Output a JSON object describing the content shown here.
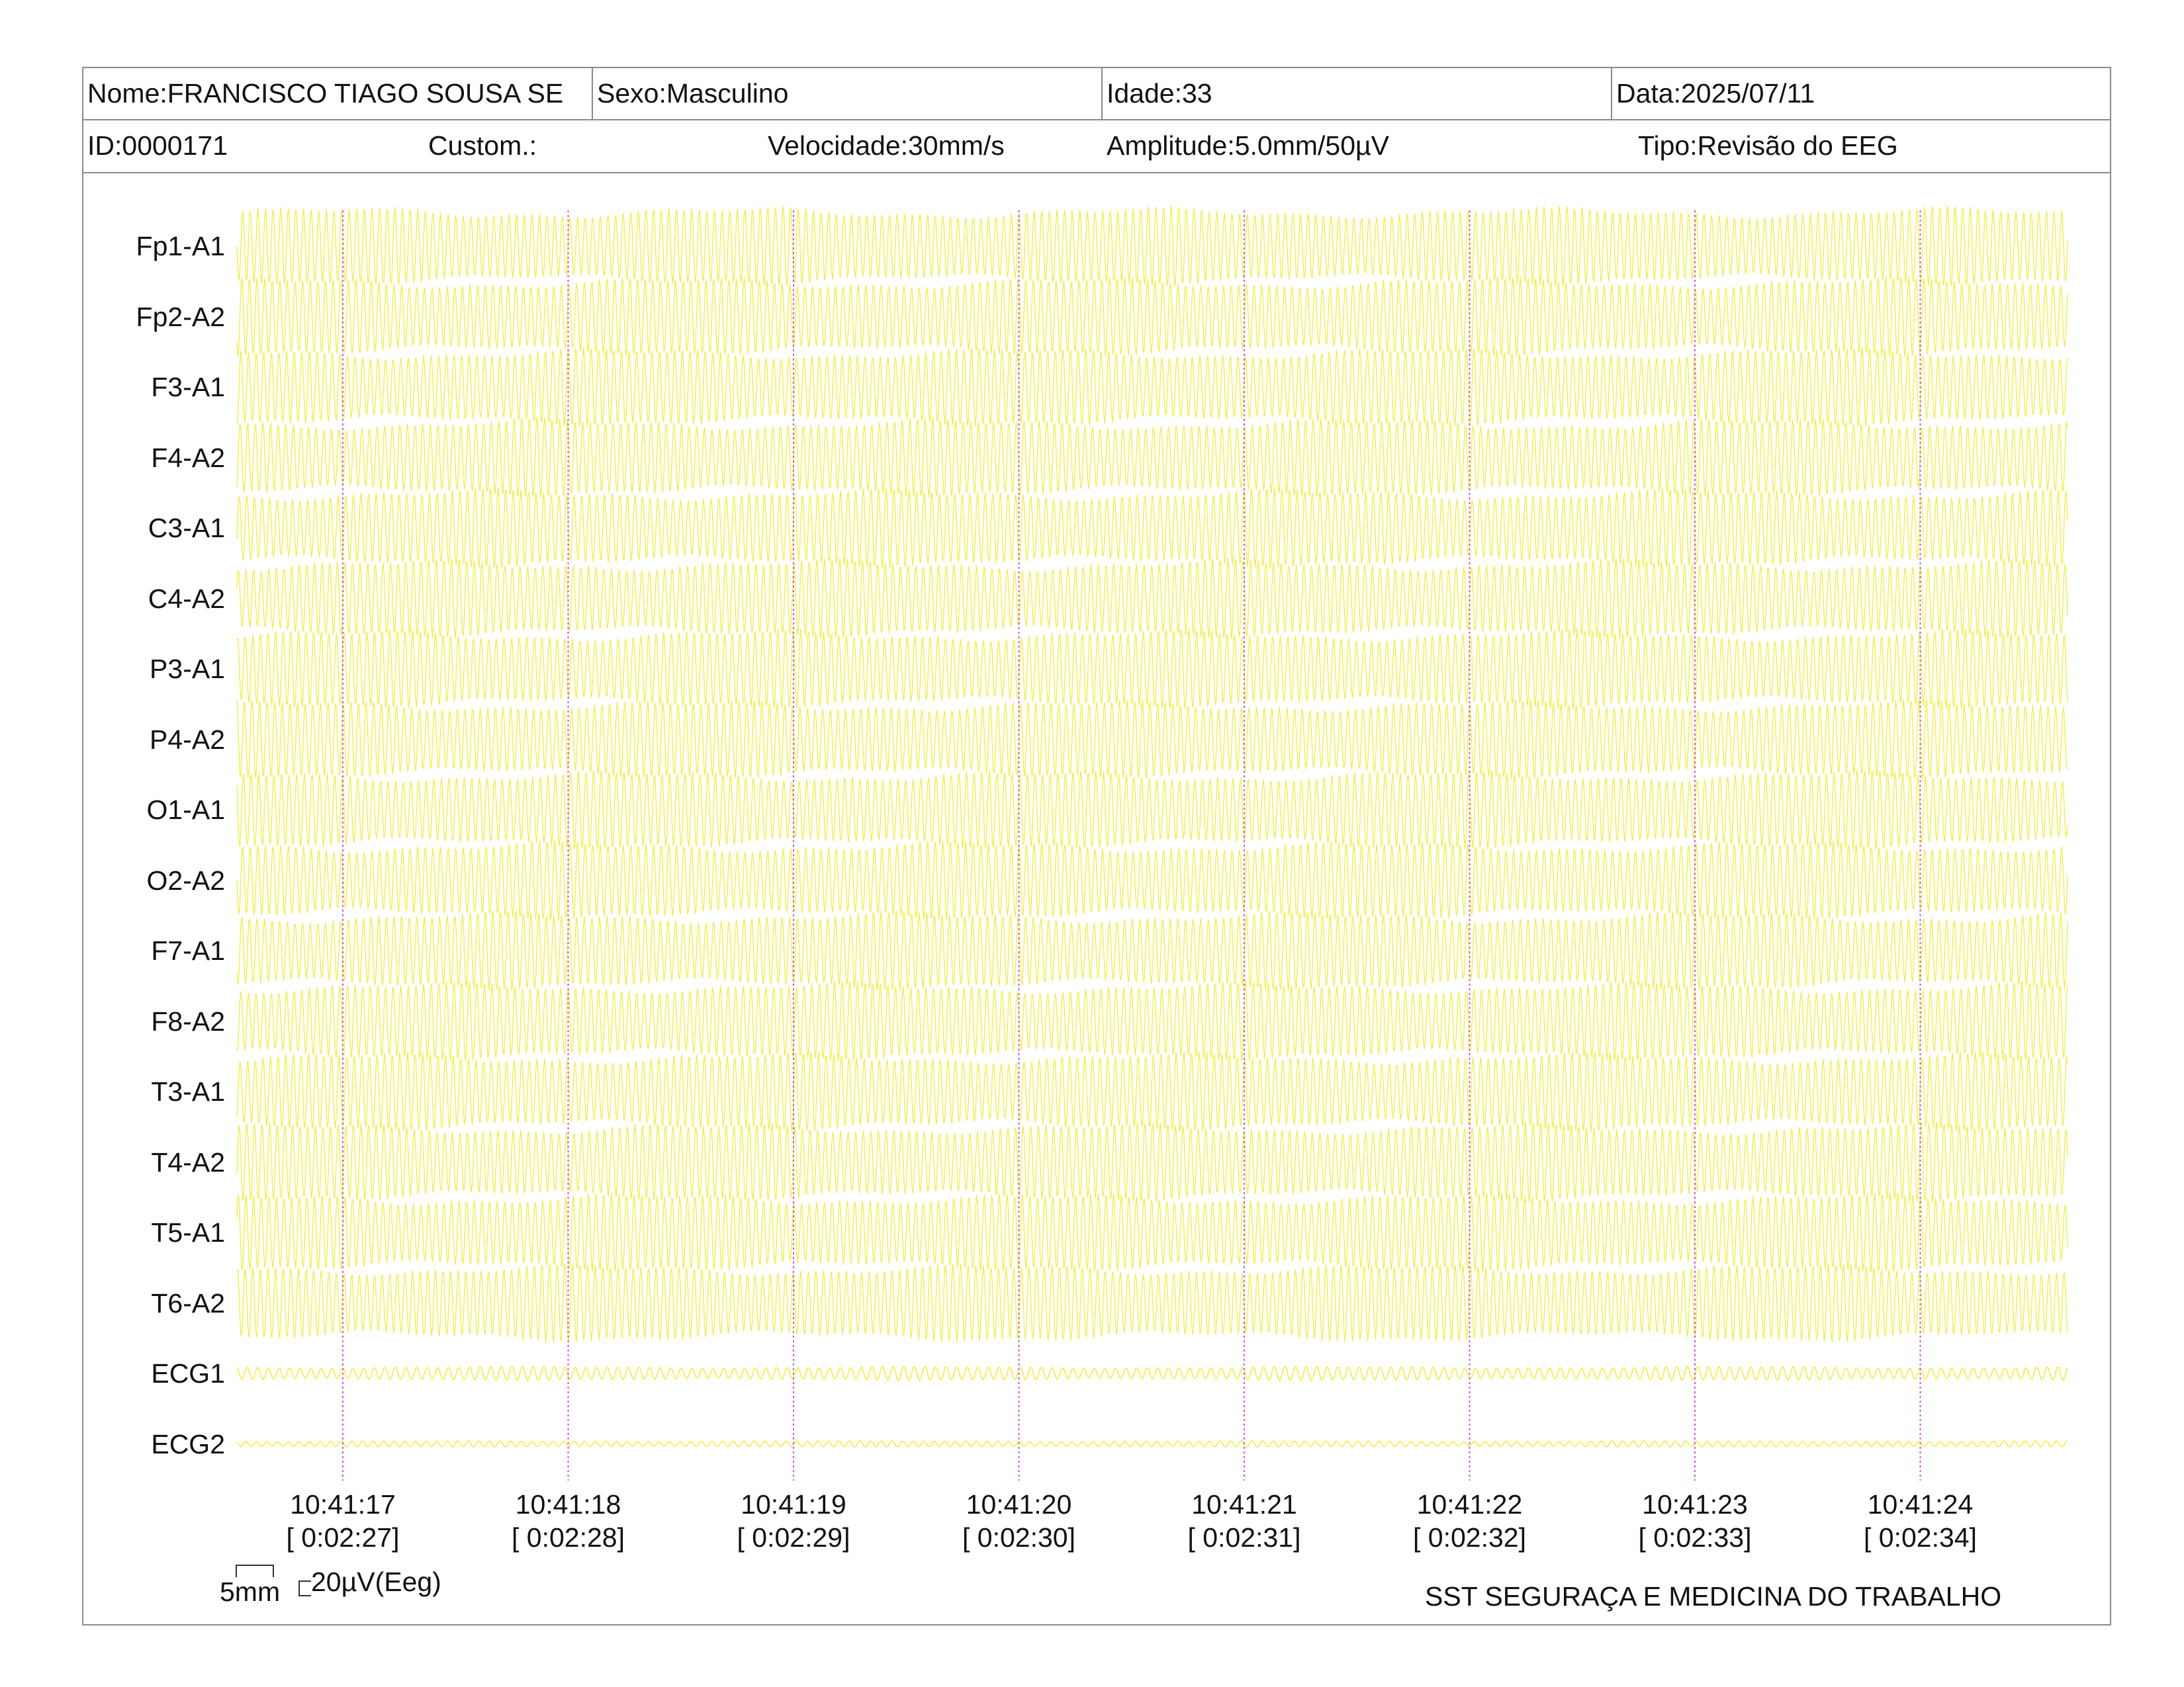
{
  "header": {
    "nome": "Nome:FRANCISCO TIAGO SOUSA SE",
    "sexo": "Sexo:Masculino",
    "idade": "Idade:33",
    "data": "Data:2025/07/11",
    "id": "ID:0000171",
    "custom": "Custom.:",
    "velocidade": "Velocidade:30mm/s",
    "amplitude": "Amplitude:5.0mm/50µV",
    "tipo": "Tipo:Revisão do EEG"
  },
  "channels": [
    "Fp1-A1",
    "Fp2-A2",
    "F3-A1",
    "F4-A2",
    "C3-A1",
    "C4-A2",
    "P3-A1",
    "P4-A2",
    "O1-A1",
    "O2-A2",
    "F7-A1",
    "F8-A2",
    "T3-A1",
    "T4-A2",
    "T5-A1",
    "T6-A2",
    "ECG1",
    "ECG2"
  ],
  "time_marks": [
    {
      "clock": "10:41:17",
      "elapsed": "[ 0:02:27]"
    },
    {
      "clock": "10:41:18",
      "elapsed": "[ 0:02:28]"
    },
    {
      "clock": "10:41:19",
      "elapsed": "[ 0:02:29]"
    },
    {
      "clock": "10:41:20",
      "elapsed": "[ 0:02:30]"
    },
    {
      "clock": "10:41:21",
      "elapsed": "[ 0:02:31]"
    },
    {
      "clock": "10:41:22",
      "elapsed": "[ 0:02:32]"
    },
    {
      "clock": "10:41:23",
      "elapsed": "[ 0:02:33]"
    },
    {
      "clock": "10:41:24",
      "elapsed": "[ 0:02:34]"
    }
  ],
  "scale": {
    "horizontal": "5mm",
    "vertical": "20µV(Eeg)"
  },
  "institution": "SST SEGURAÇA E MEDICINA DO TRABALHO",
  "colors": {
    "trace": "#f2ee3a",
    "marker": "#d24fd6",
    "border": "#8a8a8a"
  }
}
